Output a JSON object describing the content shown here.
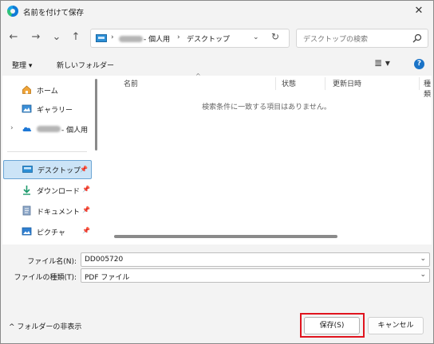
{
  "window": {
    "title": "名前を付けて保存",
    "close": "✕"
  },
  "nav": {
    "back": "←",
    "forward": "→",
    "history": "⌄",
    "up": "↑",
    "refresh": "↻"
  },
  "address": {
    "sep1": "›",
    "segment_user_suffix": "- 個人用",
    "sep2": "›",
    "segment_folder": "デスクトップ",
    "chevron": "⌄"
  },
  "search": {
    "placeholder": "デスクトップの検索"
  },
  "toolbar": {
    "organize": "整理 ▾",
    "new_folder": "新しいフォルダー",
    "view": "≣ ▾",
    "help": "?"
  },
  "sidebar": {
    "items": [
      {
        "label": "ホーム"
      },
      {
        "label": "ギャラリー"
      },
      {
        "label": "- 個人用",
        "expander": "›"
      },
      {
        "label": "デスクトップ",
        "pin": "📌"
      },
      {
        "label": "ダウンロード",
        "pin": "📌"
      },
      {
        "label": "ドキュメント",
        "pin": "📌"
      },
      {
        "label": "ピクチャ",
        "pin": "📌"
      }
    ]
  },
  "file_list": {
    "columns": [
      "名前",
      "状態",
      "更新日時",
      "種類"
    ],
    "sort_indicator": "^",
    "empty_message": "検索条件に一致する項目はありません。"
  },
  "form": {
    "filename_label": "ファイル名(N):",
    "filename_value": "DD005720",
    "filetype_label": "ファイルの種類(T):",
    "filetype_value": "PDF ファイル",
    "chevron": "⌄"
  },
  "footer": {
    "hide_folders": "^ フォルダーの非表示",
    "save": "保存(S)",
    "cancel": "キャンセル"
  },
  "colors": {
    "accent": "#1a73c7",
    "selection": "#cce4f7",
    "highlight_box": "#e0141e"
  }
}
